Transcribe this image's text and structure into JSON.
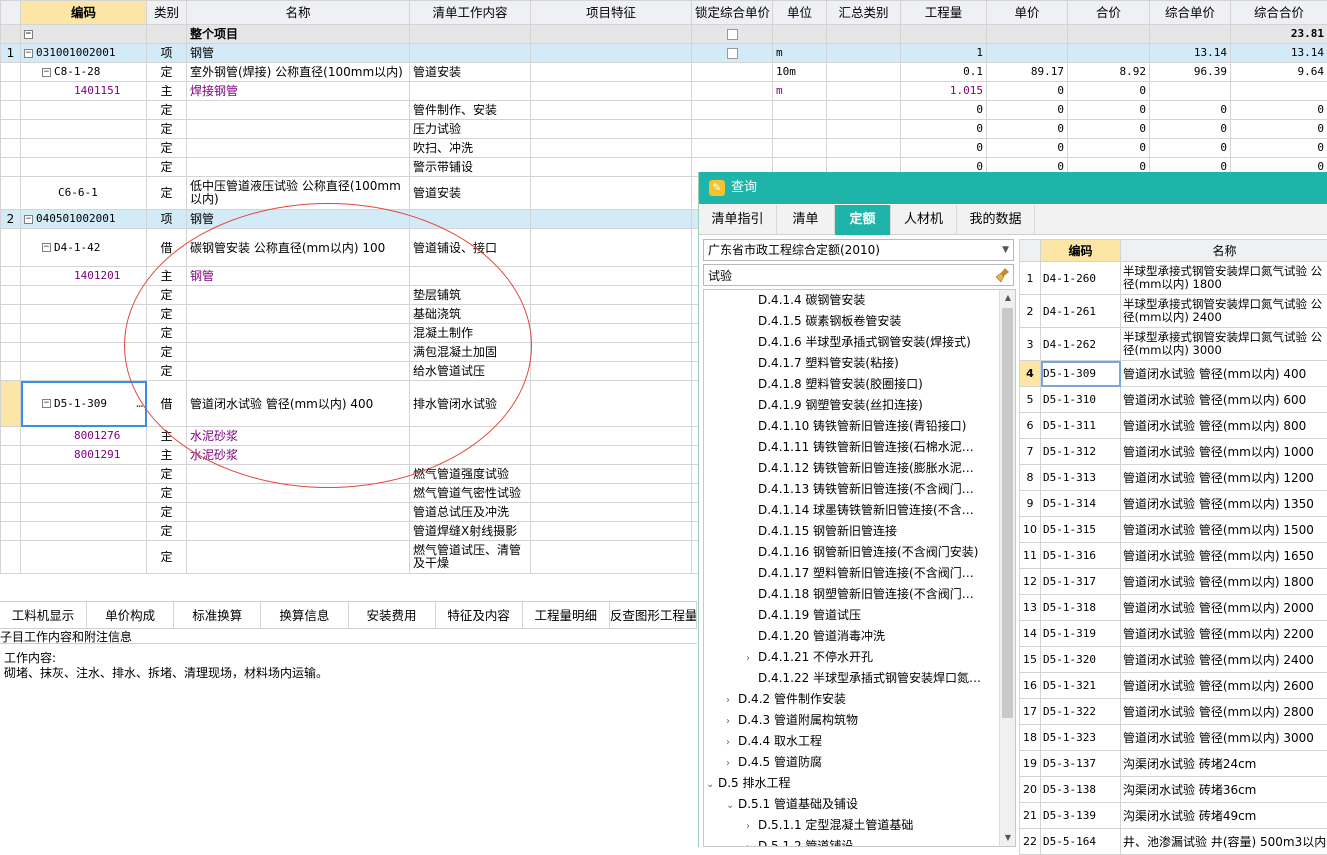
{
  "main_table": {
    "headers": [
      "",
      "编码",
      "类别",
      "名称",
      "清单工作内容",
      "项目特征",
      "锁定综合单价",
      "单位",
      "汇总类别",
      "工程量",
      "单价",
      "合价",
      "综合单价",
      "综合合价"
    ],
    "rows": [
      {
        "type": "total",
        "seq": "",
        "code": "",
        "cat": "",
        "name": "整个项目",
        "work": "",
        "unit": "",
        "qty": "",
        "price": "",
        "amount": "",
        "uprice": "",
        "total": "23.81",
        "tree": "−"
      },
      {
        "type": "xiang",
        "seq": "1",
        "code": "031001002001",
        "cat": "项",
        "name": "钢管",
        "work": "",
        "unit": "m",
        "qty": "1",
        "price": "",
        "amount": "",
        "uprice": "13.14",
        "total": "13.14",
        "tree": "−",
        "lock": true
      },
      {
        "type": "ding",
        "seq": "",
        "code": "C8-1-28",
        "cat": "定",
        "name": "室外钢管(焊接) 公称直径(100mm以内)",
        "work": "管道安装",
        "unit": "10m",
        "qty": "0.1",
        "price": "89.17",
        "amount": "8.92",
        "uprice": "96.39",
        "total": "9.64",
        "tree": "−"
      },
      {
        "type": "zhu",
        "seq": "",
        "code": "1401151",
        "cat": "主",
        "name": "焊接钢管",
        "work": "",
        "unit": "m",
        "qty": "1.015",
        "price": "0",
        "amount": "0",
        "uprice": "",
        "total": ""
      },
      {
        "type": "ding",
        "seq": "",
        "code": "",
        "cat": "定",
        "name": "",
        "work": "管件制作、安装",
        "unit": "",
        "qty": "0",
        "price": "0",
        "amount": "0",
        "uprice": "0",
        "total": "0"
      },
      {
        "type": "ding",
        "seq": "",
        "code": "",
        "cat": "定",
        "name": "",
        "work": "压力试验",
        "unit": "",
        "qty": "0",
        "price": "0",
        "amount": "0",
        "uprice": "0",
        "total": "0"
      },
      {
        "type": "ding",
        "seq": "",
        "code": "",
        "cat": "定",
        "name": "",
        "work": "吹扫、冲洗",
        "unit": "",
        "qty": "0",
        "price": "0",
        "amount": "0",
        "uprice": "0",
        "total": "0"
      },
      {
        "type": "ding",
        "seq": "",
        "code": "",
        "cat": "定",
        "name": "",
        "work": "警示带铺设",
        "unit": "",
        "qty": "0",
        "price": "0",
        "amount": "0",
        "uprice": "0",
        "total": "0"
      },
      {
        "type": "ding2",
        "seq": "",
        "code": "C6-6-1",
        "cat": "定",
        "name": "低中压管道液压试验 公称直径(100mm以内)",
        "work": "管道安装",
        "unit": "",
        "qty": "",
        "price": "",
        "amount": "",
        "uprice": "",
        "total": ""
      },
      {
        "type": "xiang",
        "seq": "2",
        "code": "040501002001",
        "cat": "项",
        "name": "钢管",
        "work": "",
        "unit": "",
        "qty": "",
        "price": "",
        "amount": "",
        "uprice": "",
        "total": "",
        "tree": "−"
      },
      {
        "type": "jie",
        "seq": "",
        "code": "D4-1-42",
        "cat": "借",
        "name": "碳钢管安装 公称直径(mm以内) 100",
        "work": "管道铺设、接口",
        "unit": "",
        "qty": "",
        "price": "",
        "amount": "",
        "uprice": "",
        "total": "",
        "tree": "−"
      },
      {
        "type": "zhu",
        "seq": "",
        "code": "1401201",
        "cat": "主",
        "name": "钢管",
        "work": "",
        "unit": "",
        "qty": "",
        "price": "",
        "amount": "",
        "uprice": "",
        "total": ""
      },
      {
        "type": "ding",
        "seq": "",
        "code": "",
        "cat": "定",
        "name": "",
        "work": "垫层铺筑",
        "unit": "",
        "qty": "",
        "price": "",
        "amount": "",
        "uprice": "",
        "total": ""
      },
      {
        "type": "ding",
        "seq": "",
        "code": "",
        "cat": "定",
        "name": "",
        "work": "基础浇筑",
        "unit": "",
        "qty": "",
        "price": "",
        "amount": "",
        "uprice": "",
        "total": ""
      },
      {
        "type": "ding",
        "seq": "",
        "code": "",
        "cat": "定",
        "name": "",
        "work": "混凝土制作",
        "unit": "",
        "qty": "",
        "price": "",
        "amount": "",
        "uprice": "",
        "total": ""
      },
      {
        "type": "ding",
        "seq": "",
        "code": "",
        "cat": "定",
        "name": "",
        "work": "满包混凝土加固",
        "unit": "",
        "qty": "",
        "price": "",
        "amount": "",
        "uprice": "",
        "total": ""
      },
      {
        "type": "ding",
        "seq": "",
        "code": "",
        "cat": "定",
        "name": "",
        "work": "给水管道试压",
        "unit": "",
        "qty": "",
        "price": "",
        "amount": "",
        "uprice": "",
        "total": ""
      },
      {
        "type": "jie2",
        "seq": "",
        "code": "D5-1-309",
        "cat": "借",
        "name": "管道闭水试验 管径(mm以内) 400",
        "work": "排水管闭水试验",
        "unit": "",
        "qty": "",
        "price": "",
        "amount": "",
        "uprice": "",
        "total": "",
        "tree": "−",
        "current": true
      },
      {
        "type": "zhu",
        "seq": "",
        "code": "8001276",
        "cat": "主",
        "name": "水泥砂浆",
        "work": "",
        "unit": "",
        "qty": "",
        "price": "",
        "amount": "",
        "uprice": "",
        "total": ""
      },
      {
        "type": "zhu",
        "seq": "",
        "code": "8001291",
        "cat": "主",
        "name": "水泥砂浆",
        "work": "",
        "unit": "",
        "qty": "",
        "price": "",
        "amount": "",
        "uprice": "",
        "total": ""
      },
      {
        "type": "ding",
        "seq": "",
        "code": "",
        "cat": "定",
        "name": "",
        "work": "燃气管道强度试验",
        "unit": "",
        "qty": "",
        "price": "",
        "amount": "",
        "uprice": "",
        "total": ""
      },
      {
        "type": "ding",
        "seq": "",
        "code": "",
        "cat": "定",
        "name": "",
        "work": "燃气管道气密性试验",
        "unit": "",
        "qty": "",
        "price": "",
        "amount": "",
        "uprice": "",
        "total": ""
      },
      {
        "type": "ding",
        "seq": "",
        "code": "",
        "cat": "定",
        "name": "",
        "work": "管道总试压及冲洗",
        "unit": "",
        "qty": "",
        "price": "",
        "amount": "",
        "uprice": "",
        "total": ""
      },
      {
        "type": "ding",
        "seq": "",
        "code": "",
        "cat": "定",
        "name": "",
        "work": "管道焊缝X射线摄影",
        "unit": "",
        "qty": "",
        "price": "",
        "amount": "",
        "uprice": "",
        "total": ""
      },
      {
        "type": "ding3",
        "seq": "",
        "code": "",
        "cat": "定",
        "name": "",
        "work": "燃气管道试压、清管及干燥",
        "unit": "",
        "qty": "",
        "price": "",
        "amount": "",
        "uprice": "",
        "total": ""
      }
    ],
    "more_indicator": "…"
  },
  "bottom_tabs": [
    "工料机显示",
    "单价构成",
    "标准换算",
    "换算信息",
    "安装费用",
    "特征及内容",
    "工程量明细",
    "反查图形工程量"
  ],
  "child_panel": {
    "title": "子目工作内容和附注信息",
    "work_label": "工作内容:",
    "work_text": "砌堵、抹灰、注水、排水、拆堵、清理现场，材料场内运输。"
  },
  "query": {
    "title": "查询",
    "tabs": [
      "清单指引",
      "清单",
      "定额",
      "人材机",
      "我的数据"
    ],
    "active_tab": "定额",
    "library": "广东省市政工程综合定额(2010)",
    "search_value": "试验",
    "tree": [
      {
        "label": "D.4.1.4 碳钢管安装",
        "level": 3,
        "arrow": ""
      },
      {
        "label": "D.4.1.5 碳素钢板卷管安装",
        "level": 3,
        "arrow": ""
      },
      {
        "label": "D.4.1.6 半球型承插式钢管安装(焊接式)",
        "level": 3,
        "arrow": ""
      },
      {
        "label": "D.4.1.7 塑料管安装(粘接)",
        "level": 3,
        "arrow": ""
      },
      {
        "label": "D.4.1.8 塑料管安装(胶圈接口)",
        "level": 3,
        "arrow": ""
      },
      {
        "label": "D.4.1.9 钢塑管安装(丝扣连接)",
        "level": 3,
        "arrow": ""
      },
      {
        "label": "D.4.1.10 铸铁管新旧管连接(青铅接口)",
        "level": 3,
        "arrow": ""
      },
      {
        "label": "D.4.1.11 铸铁管新旧管连接(石棉水泥…",
        "level": 3,
        "arrow": ""
      },
      {
        "label": "D.4.1.12 铸铁管新旧管连接(膨胀水泥…",
        "level": 3,
        "arrow": ""
      },
      {
        "label": "D.4.1.13 铸铁管新旧管连接(不含阀门…",
        "level": 3,
        "arrow": ""
      },
      {
        "label": "D.4.1.14 球墨铸铁管新旧管连接(不含…",
        "level": 3,
        "arrow": ""
      },
      {
        "label": "D.4.1.15 钢管新旧管连接",
        "level": 3,
        "arrow": ""
      },
      {
        "label": "D.4.1.16 钢管新旧管连接(不含阀门安装)",
        "level": 3,
        "arrow": ""
      },
      {
        "label": "D.4.1.17 塑料管新旧管连接(不含阀门…",
        "level": 3,
        "arrow": ""
      },
      {
        "label": "D.4.1.18 钢塑管新旧管连接(不含阀门…",
        "level": 3,
        "arrow": ""
      },
      {
        "label": "D.4.1.19 管道试压",
        "level": 3,
        "arrow": ""
      },
      {
        "label": "D.4.1.20 管道消毒冲洗",
        "level": 3,
        "arrow": ""
      },
      {
        "label": "D.4.1.21 不停水开孔",
        "level": 3,
        "arrow": "›"
      },
      {
        "label": "D.4.1.22 半球型承插式钢管安装焊口氮…",
        "level": 3,
        "arrow": ""
      },
      {
        "label": "D.4.2 管件制作安装",
        "level": 2,
        "arrow": "›"
      },
      {
        "label": "D.4.3 管道附属构筑物",
        "level": 2,
        "arrow": "›"
      },
      {
        "label": "D.4.4 取水工程",
        "level": 2,
        "arrow": "›"
      },
      {
        "label": "D.4.5 管道防腐",
        "level": 2,
        "arrow": "›"
      },
      {
        "label": "D.5 排水工程",
        "level": 1,
        "arrow": "⌄"
      },
      {
        "label": "D.5.1 管道基础及铺设",
        "level": 2,
        "arrow": "⌄"
      },
      {
        "label": "D.5.1.1 定型混凝土管道基础",
        "level": 3,
        "arrow": "›"
      },
      {
        "label": "D.5.1.2 管道铺设",
        "level": 3,
        "arrow": "›"
      }
    ],
    "result_headers": [
      "",
      "编码",
      "名称"
    ],
    "results": [
      {
        "idx": "1",
        "code": "D4-1-260",
        "name": "半球型承接式钢管安装焊口氮气试验 公径(mm以内) 1800",
        "wrap": true
      },
      {
        "idx": "2",
        "code": "D4-1-261",
        "name": "半球型承接式钢管安装焊口氮气试验 公径(mm以内) 2400",
        "wrap": true
      },
      {
        "idx": "3",
        "code": "D4-1-262",
        "name": "半球型承接式钢管安装焊口氮气试验 公径(mm以内) 3000",
        "wrap": true
      },
      {
        "idx": "4",
        "code": "D5-1-309",
        "name": "管道闭水试验 管径(mm以内) 400",
        "current": true
      },
      {
        "idx": "5",
        "code": "D5-1-310",
        "name": "管道闭水试验 管径(mm以内) 600"
      },
      {
        "idx": "6",
        "code": "D5-1-311",
        "name": "管道闭水试验 管径(mm以内) 800"
      },
      {
        "idx": "7",
        "code": "D5-1-312",
        "name": "管道闭水试验 管径(mm以内) 1000"
      },
      {
        "idx": "8",
        "code": "D5-1-313",
        "name": "管道闭水试验 管径(mm以内) 1200"
      },
      {
        "idx": "9",
        "code": "D5-1-314",
        "name": "管道闭水试验 管径(mm以内) 1350"
      },
      {
        "idx": "10",
        "code": "D5-1-315",
        "name": "管道闭水试验 管径(mm以内) 1500"
      },
      {
        "idx": "11",
        "code": "D5-1-316",
        "name": "管道闭水试验 管径(mm以内) 1650"
      },
      {
        "idx": "12",
        "code": "D5-1-317",
        "name": "管道闭水试验 管径(mm以内) 1800"
      },
      {
        "idx": "13",
        "code": "D5-1-318",
        "name": "管道闭水试验 管径(mm以内) 2000"
      },
      {
        "idx": "14",
        "code": "D5-1-319",
        "name": "管道闭水试验 管径(mm以内) 2200"
      },
      {
        "idx": "15",
        "code": "D5-1-320",
        "name": "管道闭水试验 管径(mm以内) 2400"
      },
      {
        "idx": "16",
        "code": "D5-1-321",
        "name": "管道闭水试验 管径(mm以内) 2600"
      },
      {
        "idx": "17",
        "code": "D5-1-322",
        "name": "管道闭水试验 管径(mm以内) 2800"
      },
      {
        "idx": "18",
        "code": "D5-1-323",
        "name": "管道闭水试验 管径(mm以内) 3000"
      },
      {
        "idx": "19",
        "code": "D5-3-137",
        "name": "沟渠闭水试验 砖堵24cm"
      },
      {
        "idx": "20",
        "code": "D5-3-138",
        "name": "沟渠闭水试验 砖堵36cm"
      },
      {
        "idx": "21",
        "code": "D5-3-139",
        "name": "沟渠闭水试验 砖堵49cm"
      },
      {
        "idx": "22",
        "code": "D5-5-164",
        "name": "井、池渗漏试验 井(容量) 500m3以内"
      }
    ]
  },
  "colors": {
    "accent_teal": "#1fb4a9",
    "selected_header": "#fbe6a6",
    "list_row": "#d3ebf7",
    "main_material": "#800080",
    "annotation_ellipse": "#e2463c"
  },
  "icons": {
    "tree_toggle": "minus-box-icon",
    "clear": "broom-icon",
    "dropdown": "chevron-down-icon",
    "app": "query-logo-icon"
  }
}
